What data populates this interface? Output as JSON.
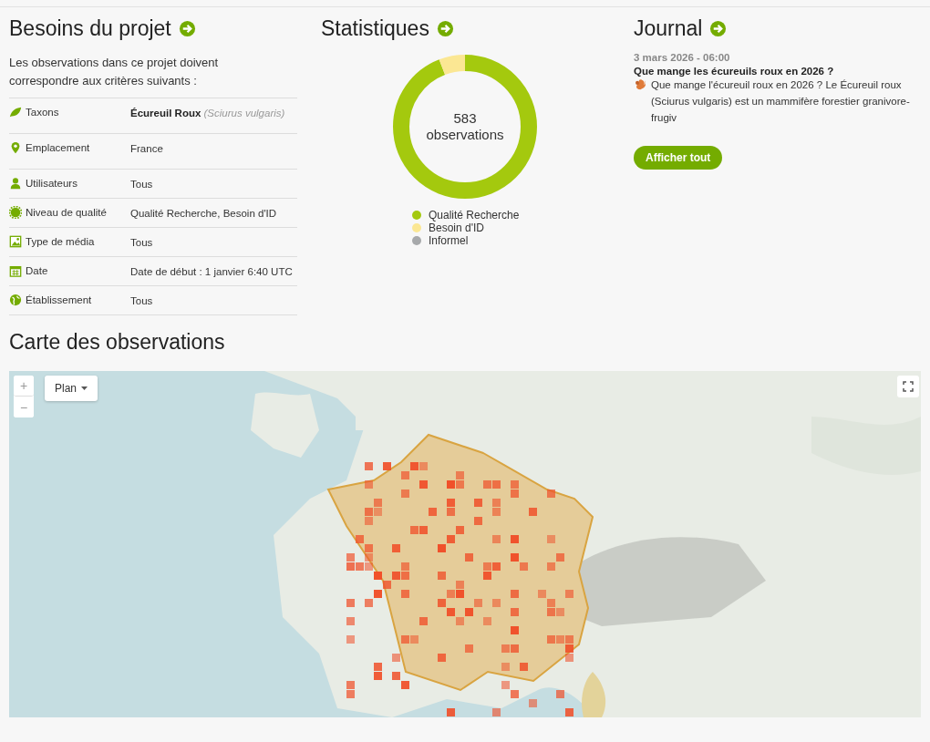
{
  "requirements": {
    "title": "Besoins du projet",
    "intro": "Les observations dans ce projet doivent correspondre aux critères suivants :",
    "rows": [
      {
        "kind": "taxon",
        "label": "Taxons",
        "value": "Écureuil Roux",
        "sci": "(Sciurus vulgaris)"
      },
      {
        "kind": "place",
        "label": "Emplacement",
        "value": "France"
      },
      {
        "kind": "user",
        "label": "Utilisateurs",
        "value": "Tous"
      },
      {
        "kind": "quality",
        "label": "Niveau de qualité",
        "value": "Qualité Recherche, Besoin d'ID"
      },
      {
        "kind": "media",
        "label": "Type de média",
        "value": "Tous"
      },
      {
        "kind": "date",
        "label": "Date",
        "value": "Date de début : 1 janvier 6:40 UTC"
      },
      {
        "kind": "site",
        "label": "Établissement",
        "value": "Tous"
      }
    ]
  },
  "stats": {
    "title": "Statistiques",
    "count": "583",
    "unit": "observations",
    "legend": [
      {
        "label": "Qualité Recherche",
        "color": "#a4c90e"
      },
      {
        "label": "Besoin d'ID",
        "color": "#fbe793"
      },
      {
        "label": "Informel",
        "color": "#a7a9ab"
      }
    ]
  },
  "journal": {
    "title": "Journal",
    "date": "3 mars 2026 - 06:00",
    "post_title": "Que mange les écureuils roux en 2026 ?",
    "excerpt": "Que mange l'écureuil roux en 2026 ? Le Écureuil roux (Sciurus vulgaris) est un mammifère forestier granivore-frugiv",
    "button": "Afficher tout"
  },
  "map": {
    "title": "Carte des observations",
    "layer_button": "Plan",
    "zoom_in": "+",
    "zoom_out": "−"
  }
}
